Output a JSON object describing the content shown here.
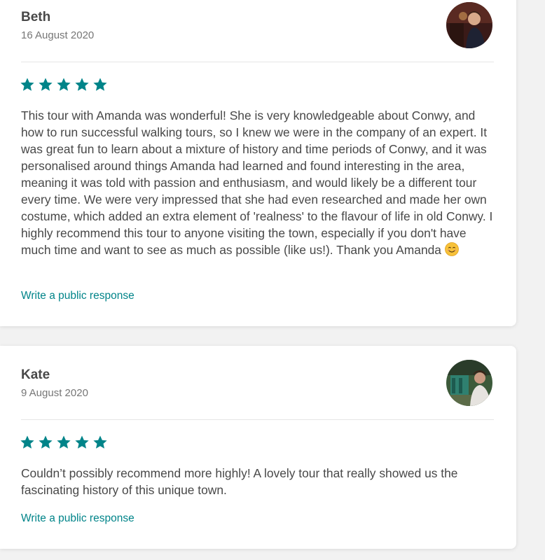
{
  "reviews": [
    {
      "name": "Beth",
      "date": "16 August 2020",
      "rating": 5,
      "text": "This tour with Amanda was wonderful! She is very knowledgeable about Conwy, and how to run successful walking tours, so I knew we were in the company of an expert. It was great fun to learn about a mixture of history and time periods of Conwy, and it was personalised around things Amanda had learned and found interesting in the area, meaning it was told with passion and enthusiasm, and would likely be a different tour every time. We were very impressed that she had even researched and made her own costume, which added an extra element of 'realness' to the flavour of life in old Conwy. I highly recommend this tour to anyone visiting the town, especially if you don't have much time and want to see as much as possible (like us!). Thank you Amanda",
      "emoji": "smiling-face-emoji",
      "respond_label": "Write a public response"
    },
    {
      "name": "Kate",
      "date": "9 August 2020",
      "rating": 5,
      "text": "Couldn’t possibly recommend more highly! A lovely tour that really showed us the fascinating history of this unique town.",
      "respond_label": "Write a public response"
    }
  ],
  "colors": {
    "accent": "#008489",
    "text": "#484848",
    "muted": "#767676"
  }
}
